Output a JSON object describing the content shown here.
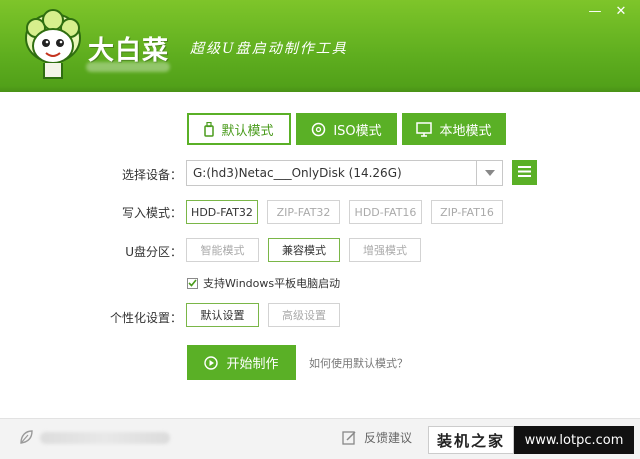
{
  "header": {
    "brand_title": "大白菜",
    "slogan": "超级U盘启动制作工具",
    "window_min": "—",
    "window_close": "✕"
  },
  "tabs": [
    {
      "label": "默认模式",
      "icon": "usb-drive-icon",
      "active": true
    },
    {
      "label": "ISO模式",
      "icon": "disc-icon",
      "active": false
    },
    {
      "label": "本地模式",
      "icon": "monitor-icon",
      "active": false
    }
  ],
  "form": {
    "device_label": "选择设备：",
    "device_value": "G:(hd3)Netac___OnlyDisk (14.26G)",
    "write_mode_label": "写入模式：",
    "write_modes": [
      {
        "label": "HDD-FAT32",
        "selected": true
      },
      {
        "label": "ZIP-FAT32",
        "selected": false
      },
      {
        "label": "HDD-FAT16",
        "selected": false
      },
      {
        "label": "ZIP-FAT16",
        "selected": false
      }
    ],
    "partition_label": "U盘分区：",
    "partitions": [
      {
        "label": "智能模式",
        "selected": false
      },
      {
        "label": "兼容模式",
        "selected": true
      },
      {
        "label": "增强模式",
        "selected": false
      }
    ],
    "tablet_boot_label": "支持Windows平板电脑启动",
    "tablet_boot_checked": true,
    "personal_label": "个性化设置：",
    "personal_options": [
      {
        "label": "默认设置",
        "selected": true
      },
      {
        "label": "高级设置",
        "selected": false
      }
    ]
  },
  "actions": {
    "start_label": "开始制作",
    "help_link": "如何使用默认模式？"
  },
  "footer": {
    "feedback_label": "反馈建议"
  },
  "watermark": {
    "left_text": "装机之家",
    "right_text": "www.lotpc.com"
  },
  "colors": {
    "brand_green": "#5ab026",
    "header_top": "#7ec52a"
  }
}
